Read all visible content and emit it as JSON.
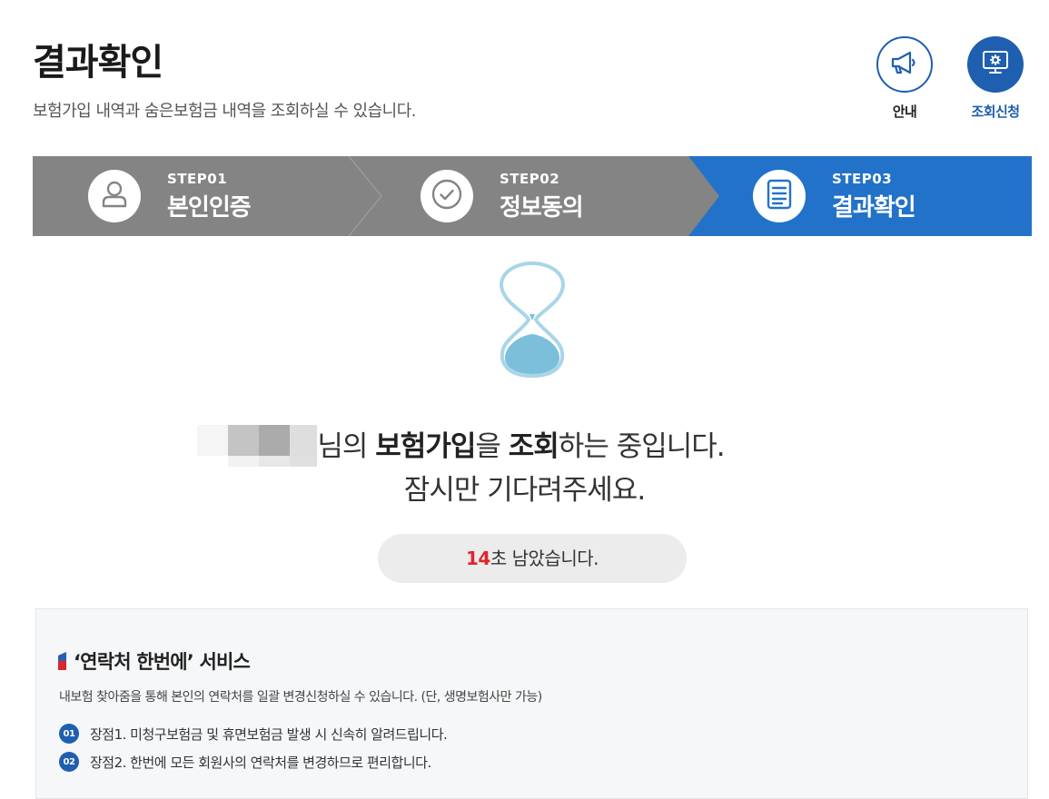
{
  "header": {
    "title": "결과확인",
    "description": "보험가입 내역과 숨은보험금 내역을 조회하실 수 있습니다."
  },
  "top_buttons": [
    {
      "label": "안내",
      "icon": "megaphone-icon"
    },
    {
      "label": "조회신청",
      "icon": "monitor-settings-icon"
    }
  ],
  "steps": [
    {
      "number": "STEP01",
      "name": "본인인증",
      "icon": "user-icon",
      "status": "done"
    },
    {
      "number": "STEP02",
      "name": "정보동의",
      "icon": "check-circle-icon",
      "status": "done"
    },
    {
      "number": "STEP03",
      "name": "결과확인",
      "icon": "document-icon",
      "status": "active"
    }
  ],
  "message": {
    "suffix": "님의 ",
    "highlight1": "보험가입",
    "mid1": "을 ",
    "highlight2": "조회",
    "mid2": "하는 중입니다.",
    "line2": "잠시만 기다려주세요."
  },
  "timer": {
    "seconds": "14",
    "suffix": "초 남았습니다."
  },
  "service": {
    "title": "‘연락처 한번에’ 서비스",
    "description": "내보험 찾아줌을 통해 본인의 연락처를 일괄 변경신청하실 수 있습니다. (단, 생명보험사만 가능)",
    "items": [
      {
        "num": "01",
        "text": "장점1. 미청구보험금 및 휴면보험금 발생 시 신속히 알려드립니다."
      },
      {
        "num": "02",
        "text": "장점2. 한번에 모든 회원사의 연락처를 변경하므로 편리합니다."
      }
    ]
  },
  "colors": {
    "accent": "#1e5fb0",
    "step_active": "#2272c9",
    "step_done": "#848484",
    "timer_number": "#e0262c",
    "hourglass": "#7bbfdb"
  }
}
